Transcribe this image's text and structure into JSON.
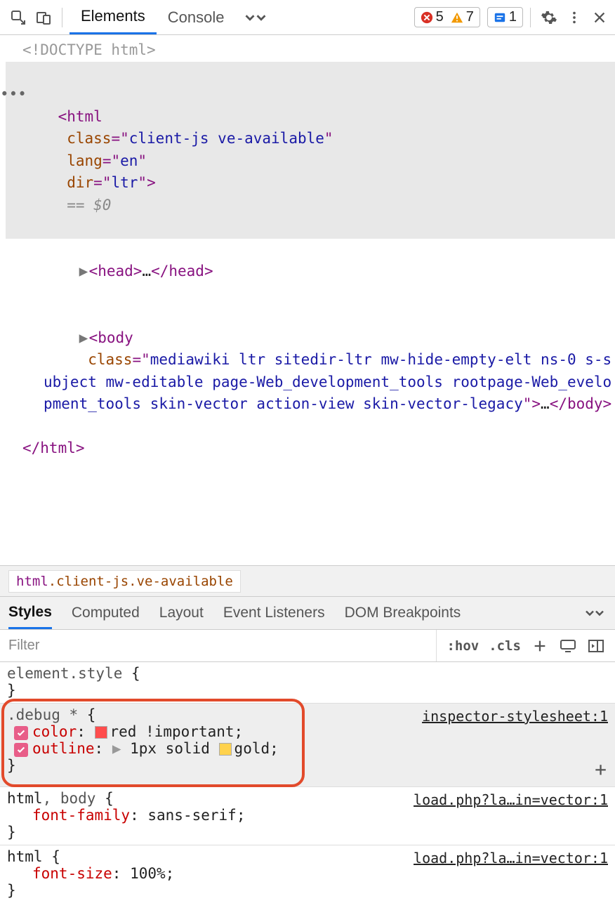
{
  "toolbar": {
    "tabs": [
      "Elements",
      "Console"
    ],
    "active_tab": 0,
    "badges": {
      "errors": "5",
      "warnings": "7",
      "issues": "1"
    }
  },
  "dom": {
    "doctype": "<!DOCTYPE html>",
    "html_open_pre": "<",
    "html_tag": "html",
    "html_class_attr": "class",
    "html_class_val": "client-js ve-available",
    "html_lang_attr": "lang",
    "html_lang_val": "en",
    "html_dir_attr": "dir",
    "html_dir_val": "ltr",
    "html_open_post": ">",
    "sel_eq": " == ",
    "sel_var": "$0",
    "head_open": "<head>",
    "head_ell": "…",
    "head_close": "</head>",
    "body_open_pre": "<",
    "body_tag": "body",
    "body_class_attr": "class",
    "body_class_val": "mediawiki ltr sitedir-ltr mw-hide-empty-elt ns-0 s-subject mw-editable page-Web_development_tools rootpage-Web_evelopment_tools skin-vector action-view skin-vector-legacy",
    "body_open_post": ">",
    "body_ell": "…",
    "body_close": "</body>",
    "html_close": "</html>"
  },
  "breadcrumb": {
    "tag": "html",
    "cls1": ".client-js",
    "cls2": ".ve-available"
  },
  "panel_tabs": [
    "Styles",
    "Computed",
    "Layout",
    "Event Listeners",
    "DOM Breakpoints"
  ],
  "panel_active": 0,
  "filter": {
    "placeholder": "Filter",
    "hov": ":hov",
    "cls": ".cls"
  },
  "rules": {
    "r0_sel": "element.style",
    "r0_open": " {",
    "r0_close": "}",
    "r1_sel": ".debug *",
    "r1_open": " {",
    "r1_src": "inspector-stylesheet:1",
    "r1_p1_name": "color",
    "r1_p1_val": "red !important",
    "r1_p1_swatch": "#ff4d4d",
    "r1_p2_name": "outline",
    "r1_p2_val": "1px solid ",
    "r1_p2_val_color": "gold",
    "r1_p2_swatch": "#ffd24d",
    "r1_close": "}",
    "r2_sel_a": "html",
    "r2_sel_sep": ", ",
    "r2_sel_b": "body",
    "r2_open": " {",
    "r2_src": "load.php?la…in=vector:1",
    "r2_p1_name": "font-family",
    "r2_p1_val": "sans-serif",
    "r2_close": "}",
    "r3_sel": "html",
    "r3_open": " {",
    "r3_src": "load.php?la…in=vector:1",
    "r3_p1_name": "font-size",
    "r3_p1_val": "100%",
    "r3_close": "}"
  }
}
